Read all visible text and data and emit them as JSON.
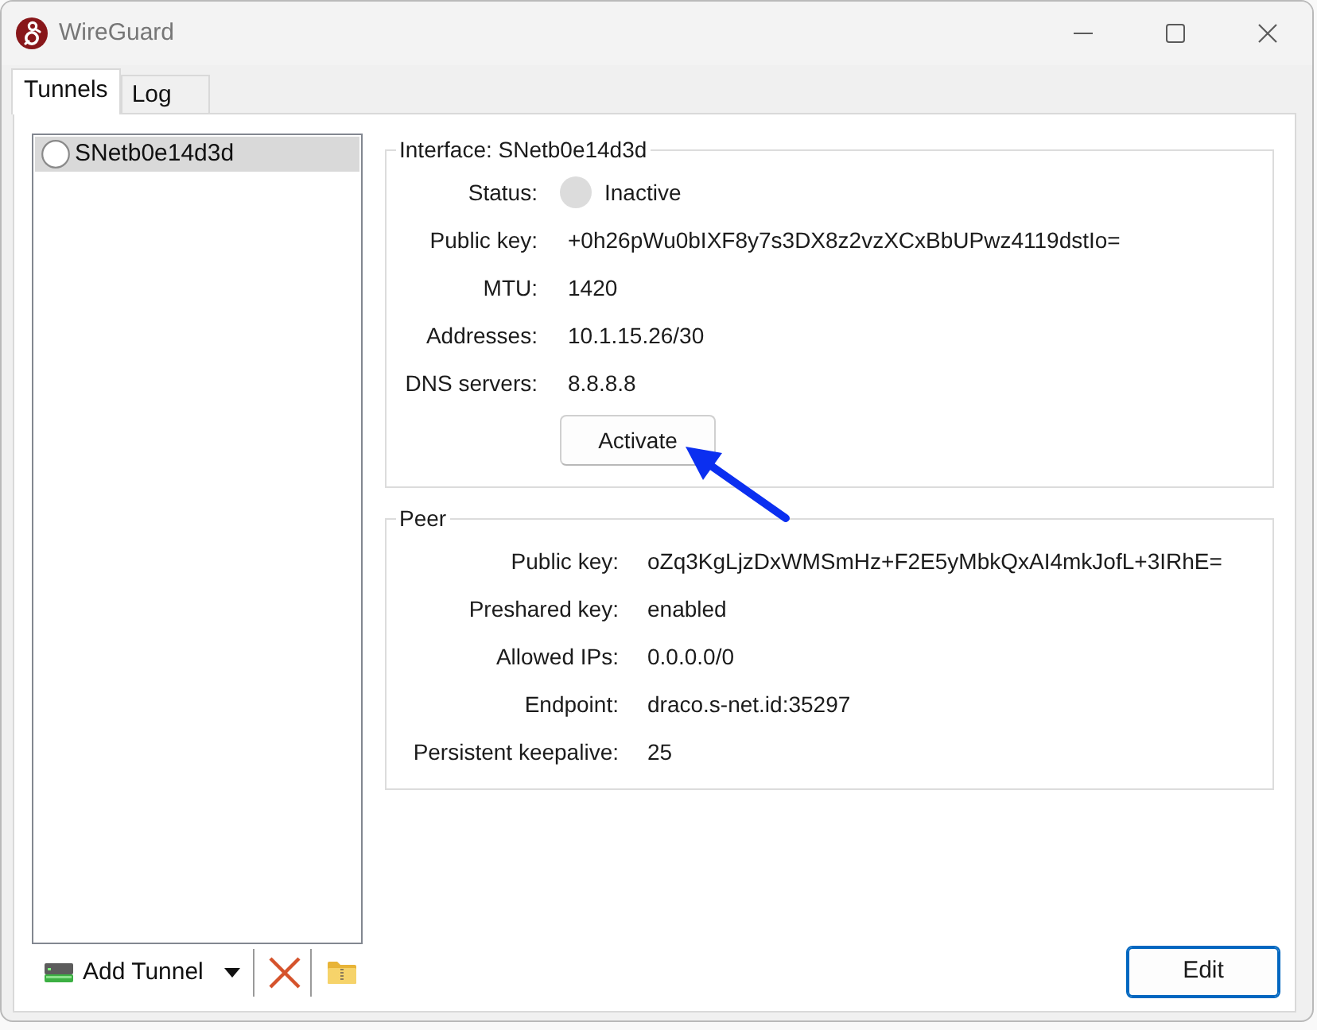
{
  "window": {
    "title": "WireGuard"
  },
  "tabs": [
    {
      "label": "Tunnels",
      "selected": true
    },
    {
      "label": "Log",
      "selected": false
    }
  ],
  "tunnels": [
    {
      "name": "SNetb0e14d3d",
      "selected": true,
      "active": false
    }
  ],
  "toolbar": {
    "add_tunnel": "Add Tunnel"
  },
  "interface": {
    "title": "Interface: SNetb0e14d3d",
    "fields": [
      {
        "kind": "status",
        "label": "Status:",
        "value": "Inactive",
        "active": false
      },
      {
        "kind": "text",
        "label": "Public key:",
        "value": "+0h26pWu0bIXF8y7s3DX8z2vzXCxBbUPwz4119dstIo="
      },
      {
        "kind": "text",
        "label": "MTU:",
        "value": "1420"
      },
      {
        "kind": "text",
        "label": "Addresses:",
        "value": "10.1.15.26/30"
      },
      {
        "kind": "text",
        "label": "DNS servers:",
        "value": "8.8.8.8"
      }
    ],
    "button": "Activate"
  },
  "peer": {
    "title": "Peer",
    "fields": [
      {
        "kind": "text",
        "label": "Public key:",
        "value": "oZq3KgLjzDxWMSmHz+F2E5yMbkQxAI4mkJofL+3IRhE="
      },
      {
        "kind": "text",
        "label": "Preshared key:",
        "value": "enabled"
      },
      {
        "kind": "text",
        "label": "Allowed IPs:",
        "value": "0.0.0.0/0"
      },
      {
        "kind": "text",
        "label": "Endpoint:",
        "value": "draco.s-net.id:35297"
      },
      {
        "kind": "text",
        "label": "Persistent keepalive:",
        "value": "25"
      }
    ]
  },
  "edit_button": "Edit"
}
